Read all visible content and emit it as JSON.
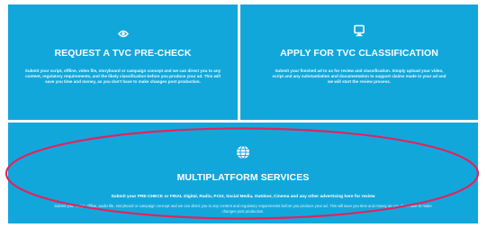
{
  "colors": {
    "tile_bg": "#12a7db",
    "text": "#ffffff",
    "highlight": "#e0245e"
  },
  "tiles": [
    {
      "icon": "eye-icon",
      "title": "REQUEST A TVC PRE-CHECK",
      "description": "Submit your script, offline, video file, storyboard or campaign concept and we can direct you to any content, regulatory requirements, and the likely classification before you produce your ad. This will save you time and money, as you don't have to make changes post production."
    },
    {
      "icon": "monitor-icon",
      "title": "APPLY FOR TVC CLASSIFICATION",
      "description": "Submit your finished ad to us for review and classification. Simply upload your video, script and any substantiation and documentation to support claims made in your ad and we will start the review process."
    },
    {
      "icon": "globe-icon",
      "title": "MULTIPLATFORM SERVICES",
      "description": "Submit your PRE-CHECK or FINAL Digital, Radio, Print, Social Media, Outdoor, Cinema and any other advertising here for review",
      "sub_description": "Submit your script, offline, audio file, storyboard or campaign concept and we can direct you to any content and regulatory requirements before you produce your ad. This will save you time and money as you don't have to make changes post production."
    }
  ]
}
